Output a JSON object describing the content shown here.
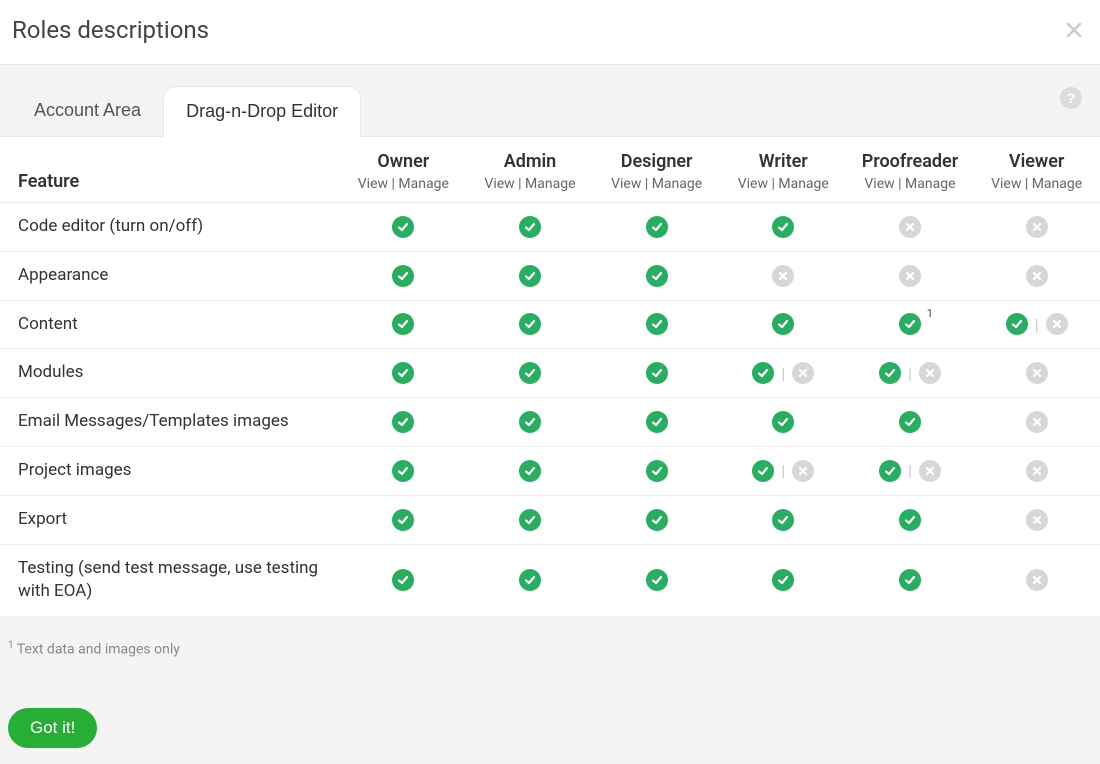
{
  "title": "Roles descriptions",
  "tabs": [
    {
      "label": "Account Area"
    },
    {
      "label": "Drag-n-Drop Editor"
    }
  ],
  "active_tab_index": 1,
  "help_glyph": "?",
  "header": {
    "feature_label": "Feature",
    "subheader": "View | Manage"
  },
  "roles": [
    {
      "name": "Owner"
    },
    {
      "name": "Admin"
    },
    {
      "name": "Designer"
    },
    {
      "name": "Writer"
    },
    {
      "name": "Proofreader"
    },
    {
      "name": "Viewer"
    }
  ],
  "cell_footnote_ref": "1",
  "features": [
    {
      "name": "Code editor (turn on/off)",
      "cells": [
        {
          "type": "single",
          "value": true
        },
        {
          "type": "single",
          "value": true
        },
        {
          "type": "single",
          "value": true
        },
        {
          "type": "single",
          "value": true
        },
        {
          "type": "single",
          "value": false
        },
        {
          "type": "single",
          "value": false
        }
      ]
    },
    {
      "name": "Appearance",
      "cells": [
        {
          "type": "single",
          "value": true
        },
        {
          "type": "single",
          "value": true
        },
        {
          "type": "single",
          "value": true
        },
        {
          "type": "single",
          "value": false
        },
        {
          "type": "single",
          "value": false
        },
        {
          "type": "single",
          "value": false
        }
      ]
    },
    {
      "name": "Content",
      "cells": [
        {
          "type": "single",
          "value": true
        },
        {
          "type": "single",
          "value": true
        },
        {
          "type": "single",
          "value": true
        },
        {
          "type": "single",
          "value": true
        },
        {
          "type": "single",
          "value": true,
          "footnote": true
        },
        {
          "type": "split",
          "view": true,
          "manage": false
        }
      ]
    },
    {
      "name": "Modules",
      "cells": [
        {
          "type": "single",
          "value": true
        },
        {
          "type": "single",
          "value": true
        },
        {
          "type": "single",
          "value": true
        },
        {
          "type": "split",
          "view": true,
          "manage": false
        },
        {
          "type": "split",
          "view": true,
          "manage": false
        },
        {
          "type": "single",
          "value": false
        }
      ]
    },
    {
      "name": "Email Messages/Templates images",
      "cells": [
        {
          "type": "single",
          "value": true
        },
        {
          "type": "single",
          "value": true
        },
        {
          "type": "single",
          "value": true
        },
        {
          "type": "single",
          "value": true
        },
        {
          "type": "single",
          "value": true
        },
        {
          "type": "single",
          "value": false
        }
      ]
    },
    {
      "name": "Project images",
      "cells": [
        {
          "type": "single",
          "value": true
        },
        {
          "type": "single",
          "value": true
        },
        {
          "type": "single",
          "value": true
        },
        {
          "type": "split",
          "view": true,
          "manage": false
        },
        {
          "type": "split",
          "view": true,
          "manage": false
        },
        {
          "type": "single",
          "value": false
        }
      ]
    },
    {
      "name": "Export",
      "cells": [
        {
          "type": "single",
          "value": true
        },
        {
          "type": "single",
          "value": true
        },
        {
          "type": "single",
          "value": true
        },
        {
          "type": "single",
          "value": true
        },
        {
          "type": "single",
          "value": true
        },
        {
          "type": "single",
          "value": false
        }
      ]
    },
    {
      "name": "Testing (send test message, use testing with EOA)",
      "cells": [
        {
          "type": "single",
          "value": true
        },
        {
          "type": "single",
          "value": true
        },
        {
          "type": "single",
          "value": true
        },
        {
          "type": "single",
          "value": true
        },
        {
          "type": "single",
          "value": true
        },
        {
          "type": "single",
          "value": false
        }
      ]
    }
  ],
  "footnote": {
    "ref": "1",
    "text": " Text data and images only"
  },
  "got_it_label": "Got it!"
}
